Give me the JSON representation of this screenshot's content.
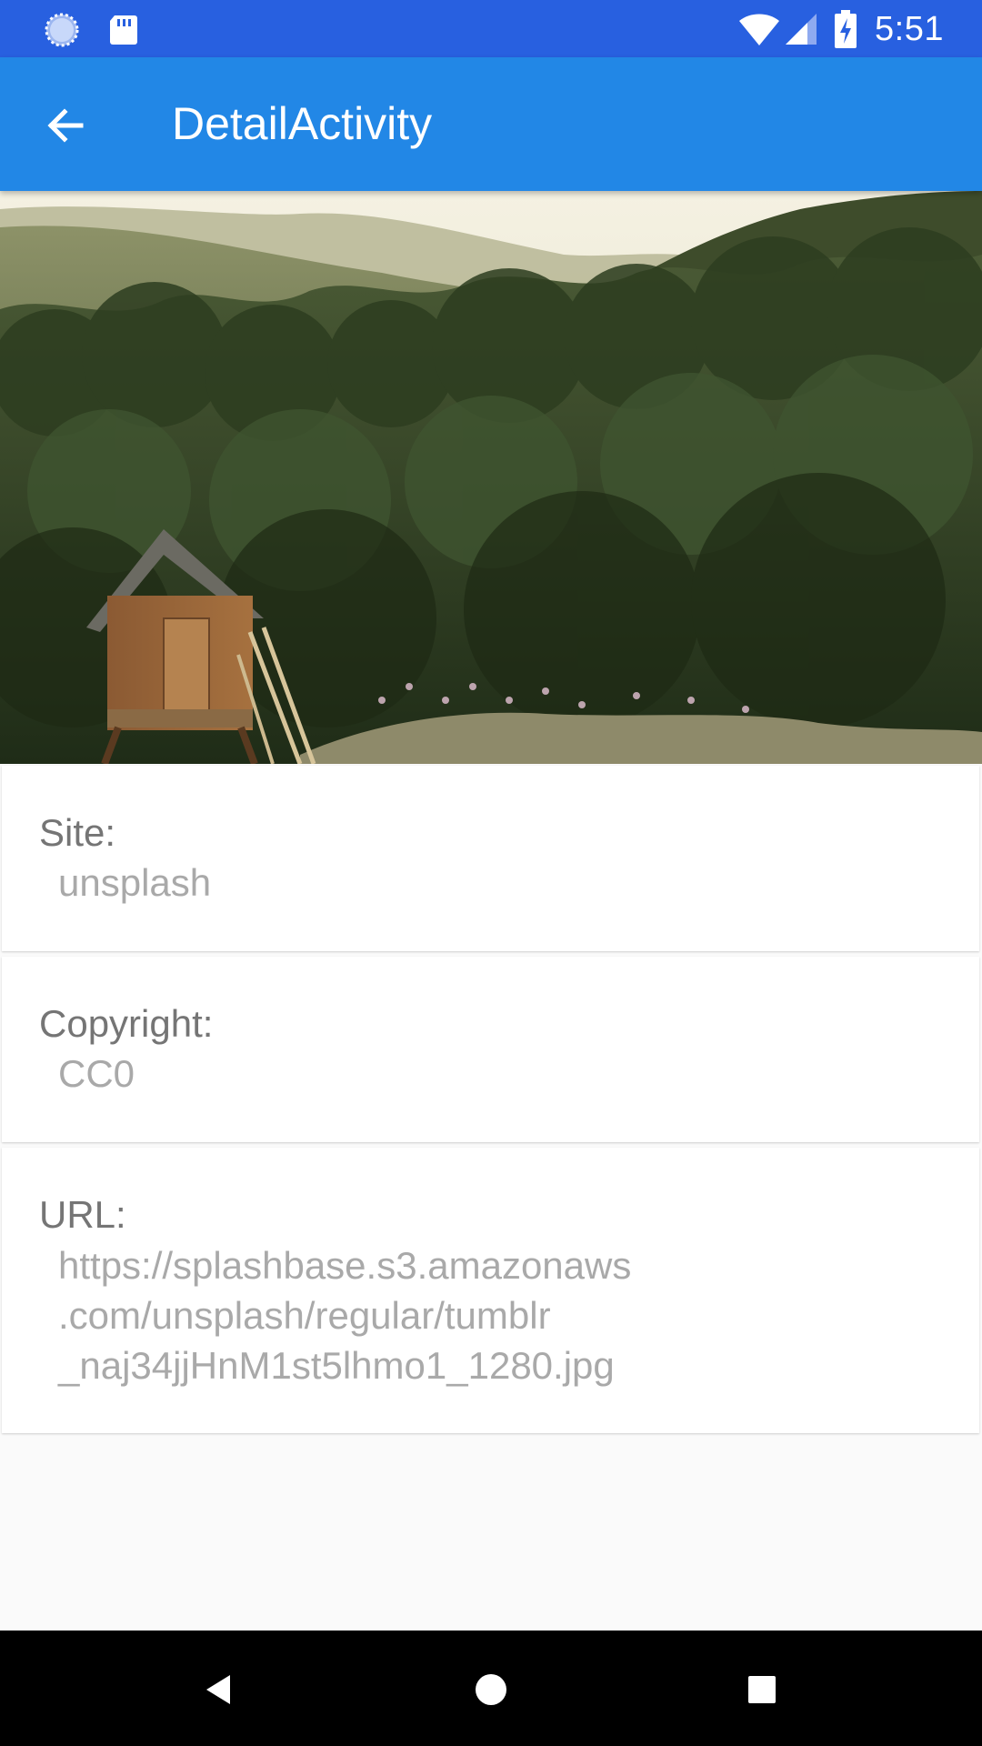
{
  "status_bar": {
    "time": "5:51",
    "icons": [
      "sync-icon",
      "sd-card-icon",
      "wifi-icon",
      "cell-signal-icon",
      "battery-charging-icon"
    ]
  },
  "app_bar": {
    "title": "DetailActivity",
    "back_icon": "arrow-back-icon"
  },
  "hero_image": {
    "description": "cabin-in-forest-photo"
  },
  "details": [
    {
      "label": "Site:",
      "value": "unsplash"
    },
    {
      "label": "Copyright:",
      "value": "CC0"
    },
    {
      "label": "URL:",
      "value_lines": [
        "https://splashbase.s3.amazonaws",
        ".com/unsplash/regular/tumblr",
        "_naj34jjHnM1st5lhmo1_1280.jpg"
      ]
    }
  ],
  "nav_bar": {
    "icons": [
      "back-triangle-icon",
      "home-circle-icon",
      "recents-square-icon"
    ]
  },
  "colors": {
    "status_bar": "#2860e0",
    "app_bar": "#2287e6",
    "label_text": "#757575",
    "value_text": "#a9a9a9"
  }
}
